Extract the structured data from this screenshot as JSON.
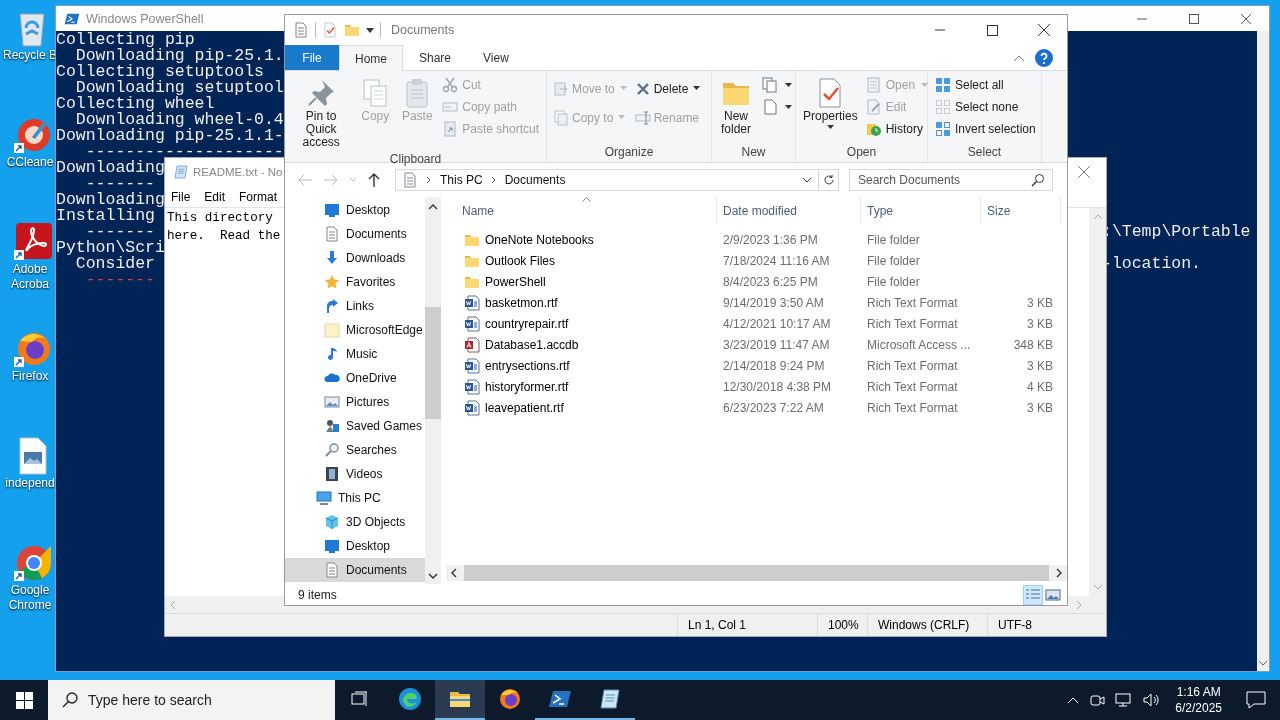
{
  "desktop_icons": [
    {
      "lines": [
        "Recycle B"
      ]
    },
    {
      "lines": [
        "CCleane"
      ]
    },
    {
      "lines": [
        "Adobe",
        "Acroba"
      ]
    },
    {
      "lines": [
        "Firefox"
      ]
    },
    {
      "lines": [
        "independ"
      ]
    },
    {
      "lines": [
        "Google",
        "Chrome"
      ]
    }
  ],
  "powershell": {
    "title": "Windows PowerShell",
    "lines": [
      {
        "text": "Collecting pip",
        "error": false
      },
      {
        "text": "  Downloading pip-25.1.",
        "error": false
      },
      {
        "text": "Collecting setuptools",
        "error": false
      },
      {
        "text": "  Downloading setuptool",
        "error": false
      },
      {
        "text": "Collecting wheel",
        "error": false
      },
      {
        "text": "  Downloading wheel-0.4",
        "error": false
      },
      {
        "text": "Downloading pip-25.1.1-",
        "error": false
      },
      {
        "text": "   --------------------",
        "error": false
      },
      {
        "text": "Downloading",
        "error": false
      },
      {
        "text": "   -------",
        "error": false
      },
      {
        "text": "Downloading",
        "error": false
      },
      {
        "text": "Installing",
        "error": false
      },
      {
        "text": "   -------",
        "error": false,
        "tail": ":\\Temp\\Portable"
      },
      {
        "text": "Python\\Scri",
        "error": false
      },
      {
        "text": "  Consider",
        "error": false,
        "tail": "-location."
      },
      {
        "text": "   -------",
        "error": true
      }
    ]
  },
  "notepad": {
    "title": "README.txt - No",
    "menu": [
      "File",
      "Edit",
      "Format"
    ],
    "text_lines": [
      "This directory",
      "here.  Read the"
    ],
    "status": [
      "Ln 1, Col 1",
      "100%",
      "Windows (CRLF)",
      "UTF-8"
    ]
  },
  "explorer": {
    "title": "Documents",
    "tabs": [
      {
        "label": "File",
        "kind": "file",
        "selected": false
      },
      {
        "label": "Home",
        "kind": "tab",
        "selected": true
      },
      {
        "label": "Share",
        "kind": "tab",
        "selected": false
      },
      {
        "label": "View",
        "kind": "tab",
        "selected": false
      }
    ],
    "ribbon": [
      {
        "label": "Clipboard",
        "columns": [
          [
            {
              "label": "Pin to Quick access",
              "kind": "large",
              "disabled": false,
              "dropdown": false
            }
          ],
          [
            {
              "label": "Copy",
              "kind": "large",
              "disabled": true,
              "dropdown": false
            }
          ],
          [
            {
              "label": "Paste",
              "kind": "large",
              "disabled": true,
              "dropdown": false
            }
          ],
          [
            {
              "label": "Cut",
              "kind": "small",
              "disabled": true,
              "dropdown": false
            },
            {
              "label": "Copy path",
              "kind": "small",
              "disabled": true,
              "dropdown": false
            },
            {
              "label": "Paste shortcut",
              "kind": "small",
              "disabled": true,
              "dropdown": false
            }
          ]
        ]
      },
      {
        "label": "Organize",
        "columns": [
          [
            {
              "label": "Move to",
              "kind": "small",
              "disabled": true,
              "dropdown": true
            },
            {
              "label": "Copy to",
              "kind": "small",
              "disabled": true,
              "dropdown": true
            }
          ],
          [
            {
              "label": "Delete",
              "kind": "small",
              "disabled": false,
              "dropdown": true
            },
            {
              "label": "Rename",
              "kind": "small",
              "disabled": true,
              "dropdown": false
            }
          ]
        ]
      },
      {
        "label": "New",
        "columns": [
          [
            {
              "label": "New folder",
              "kind": "large",
              "disabled": false,
              "dropdown": false
            }
          ],
          [
            {
              "kind": "small",
              "disabled": false,
              "dropdown": true
            },
            {
              "kind": "small",
              "disabled": false,
              "dropdown": true
            }
          ]
        ]
      },
      {
        "label": "Open",
        "columns": [
          [
            {
              "label": "Properties",
              "kind": "large",
              "disabled": false,
              "dropdown": true
            }
          ],
          [
            {
              "label": "Open",
              "kind": "small",
              "disabled": true,
              "dropdown": true
            },
            {
              "label": "Edit",
              "kind": "small",
              "disabled": true,
              "dropdown": false
            },
            {
              "label": "History",
              "kind": "small",
              "disabled": false,
              "dropdown": false
            }
          ]
        ]
      },
      {
        "label": "Select",
        "columns": [
          [
            {
              "label": "Select all",
              "kind": "small",
              "disabled": false,
              "dropdown": false
            },
            {
              "label": "Select none",
              "kind": "small",
              "disabled": false,
              "dropdown": false
            },
            {
              "label": "Invert selection",
              "kind": "small",
              "disabled": false,
              "dropdown": false
            }
          ]
        ]
      }
    ],
    "address": {
      "crumbs": [
        "This PC",
        "Documents"
      ]
    },
    "search": {
      "placeholder": "Search Documents"
    },
    "nav_pane": {
      "items": [
        {
          "label": "Desktop",
          "selected": false
        },
        {
          "label": "Documents",
          "selected": false
        },
        {
          "label": "Downloads",
          "selected": false
        },
        {
          "label": "Favorites",
          "selected": false
        },
        {
          "label": "Links",
          "selected": false
        },
        {
          "label": "MicrosoftEdge",
          "selected": false
        },
        {
          "label": "Music",
          "selected": false
        },
        {
          "label": "OneDrive",
          "selected": false
        },
        {
          "label": "Pictures",
          "selected": false
        },
        {
          "label": "Saved Games",
          "selected": false
        },
        {
          "label": "Searches",
          "selected": false
        },
        {
          "label": "Videos",
          "selected": false
        }
      ],
      "tree": [
        {
          "label": "This PC",
          "selected": false,
          "children": [
            {
              "label": "3D Objects",
              "selected": false
            },
            {
              "label": "Desktop",
              "selected": false
            },
            {
              "label": "Documents",
              "selected": true
            }
          ]
        }
      ]
    },
    "columns": [
      "Name",
      "Date modified",
      "Type",
      "Size"
    ],
    "rows": [
      {
        "kind": "folder",
        "name": "OneNote Notebooks",
        "date": "2/9/2023 1:36 PM",
        "type": "File folder"
      },
      {
        "kind": "folder",
        "name": "Outlook Files",
        "date": "7/18/2024 11:16 AM",
        "type": "File folder"
      },
      {
        "kind": "folder",
        "name": "PowerShell",
        "date": "8/4/2023 6:25 PM",
        "type": "File folder"
      },
      {
        "kind": "rtf",
        "name": "basketmon.rtf",
        "date": "9/14/2019 3:50 AM",
        "type": "Rich Text Format",
        "size": "3 KB"
      },
      {
        "kind": "rtf",
        "name": "countryrepair.rtf",
        "date": "4/12/2021 10:17 AM",
        "type": "Rich Text Format",
        "size": "3 KB"
      },
      {
        "kind": "access",
        "name": "Database1.accdb",
        "date": "3/23/2019 11:47 AM",
        "type": "Microsoft Access ...",
        "size": "348 KB"
      },
      {
        "kind": "rtf",
        "name": "entrysections.rtf",
        "date": "2/14/2018 9:24 PM",
        "type": "Rich Text Format",
        "size": "3 KB"
      },
      {
        "kind": "rtf",
        "name": "historyformer.rtf",
        "date": "12/30/2018 4:38 PM",
        "type": "Rich Text Format",
        "size": "4 KB"
      },
      {
        "kind": "rtf",
        "name": "leavepatient.rtf",
        "date": "6/23/2023 7:22 AM",
        "type": "Rich Text Format",
        "size": "3 KB"
      }
    ],
    "status": "9 items",
    "views": [
      {
        "selected": true
      },
      {
        "selected": false
      }
    ]
  },
  "taskbar": {
    "search": {
      "placeholder": "Type here to search"
    },
    "apps": [
      {
        "running": false,
        "selected": false
      },
      {
        "running": true,
        "selected": true
      },
      {
        "running": false,
        "selected": false
      },
      {
        "running": true,
        "selected": false
      },
      {
        "running": true,
        "selected": false
      }
    ],
    "clock": {
      "time": "1:16 AM",
      "date": "6/2/2025"
    }
  }
}
